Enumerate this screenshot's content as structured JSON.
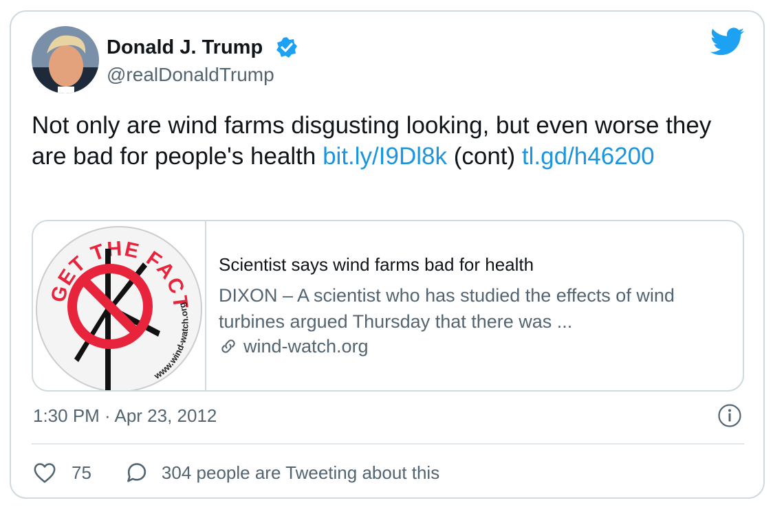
{
  "tweet": {
    "author_name": "Donald J. Trump",
    "author_handle": "@realDonaldTrump",
    "text_parts": {
      "line1": "Not only are wind farms disgusting looking, but even worse they are bad for people's health ",
      "link1": "bit.ly/I9Dl8k",
      "middle": " (cont) ",
      "link2": "tl.gd/h46200"
    },
    "timestamp": "1:30 PM · Apr 23, 2012",
    "likes": "75",
    "tweeting_label": "304 people are Tweeting about this"
  },
  "link_card": {
    "title": "Scientist says wind farms bad for health",
    "description": "DIXON – A scientist who has studied the effects of wind turbines argued Thursday that there was ...",
    "domain": "wind-watch.org",
    "image_text_top": "GET THE FACTS",
    "image_text_bottom": "www.wind-watch.org"
  },
  "icons": {
    "verified": "verified-badge-icon",
    "brand": "twitter-bird-icon",
    "link": "link-chain-icon",
    "info": "info-icon",
    "like": "heart-icon",
    "reply": "speech-bubble-icon"
  },
  "colors": {
    "accent": "#1b95e0",
    "secondary_text": "#536471",
    "primary_text": "#0f1419",
    "border": "#cfd9de",
    "no_symbol": "#e8243c"
  }
}
